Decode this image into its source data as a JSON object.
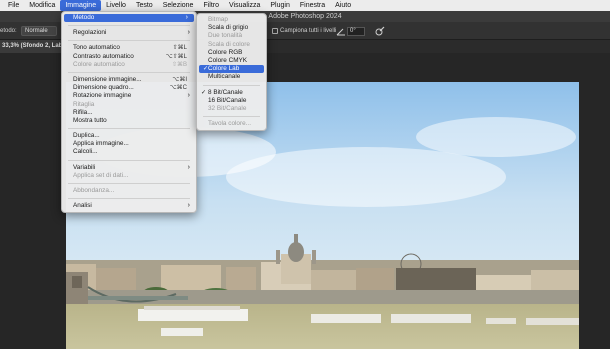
{
  "menubar": {
    "items": [
      "File",
      "Modifica",
      "Immagine",
      "Livello",
      "Testo",
      "Selezione",
      "Filtro",
      "Visualizza",
      "Plugin",
      "Finestra",
      "Aiuto"
    ],
    "active_index": 2
  },
  "titlebar": {
    "title": "Adobe Photoshop 2024"
  },
  "optionsbar": {
    "method_label": "etodo:",
    "method_value": "Normale",
    "sample_all_label": "Campiona tutti i livelli",
    "angle_value": "0°"
  },
  "document_tab": {
    "label": "33,3% (Sfondo 2, Lab"
  },
  "image_menu": {
    "items": [
      {
        "label": "Metodo",
        "arrow": "›",
        "highlighted": true
      },
      {
        "sep": true
      },
      {
        "label": "Regolazioni",
        "arrow": "›"
      },
      {
        "sep": true
      },
      {
        "label": "Tono automatico",
        "shortcut": "⇧⌘L"
      },
      {
        "label": "Contrasto automatico",
        "shortcut": "⌥⇧⌘L"
      },
      {
        "label": "Colore automatico",
        "shortcut": "⇧⌘B",
        "disabled": true
      },
      {
        "sep": true
      },
      {
        "label": "Dimensione immagine...",
        "shortcut": "⌥⌘I"
      },
      {
        "label": "Dimensione quadro...",
        "shortcut": "⌥⌘C"
      },
      {
        "label": "Rotazione immagine",
        "arrow": "›"
      },
      {
        "label": "Ritaglia",
        "disabled": true
      },
      {
        "label": "Rifila..."
      },
      {
        "label": "Mostra tutto"
      },
      {
        "sep": true
      },
      {
        "label": "Duplica..."
      },
      {
        "label": "Applica immagine..."
      },
      {
        "label": "Calcoli..."
      },
      {
        "sep": true
      },
      {
        "label": "Variabili",
        "arrow": "›"
      },
      {
        "label": "Applica set di dati...",
        "disabled": true
      },
      {
        "sep": true
      },
      {
        "label": "Abbondanza...",
        "disabled": true
      },
      {
        "sep": true
      },
      {
        "label": "Analisi",
        "arrow": "›"
      }
    ]
  },
  "mode_submenu": {
    "items": [
      {
        "label": "Bitmap",
        "disabled": true
      },
      {
        "label": "Scala di grigio"
      },
      {
        "label": "Due tonalità",
        "disabled": true
      },
      {
        "label": "Scala di colore",
        "disabled": true
      },
      {
        "label": "Colore RGB"
      },
      {
        "label": "Colore CMYK"
      },
      {
        "label": "Colore Lab",
        "checked": true,
        "highlighted": true
      },
      {
        "label": "Multicanale"
      },
      {
        "sep": true
      },
      {
        "label": "8 Bit/Canale",
        "checked": true
      },
      {
        "label": "16 Bit/Canale"
      },
      {
        "label": "32 Bit/Canale",
        "disabled": true
      },
      {
        "sep": true
      },
      {
        "label": "Tavola colore...",
        "disabled": true
      }
    ]
  },
  "colors": {
    "accent": "#3a6bd9",
    "menu_bg": "#ececec",
    "app_bg": "#262626"
  }
}
